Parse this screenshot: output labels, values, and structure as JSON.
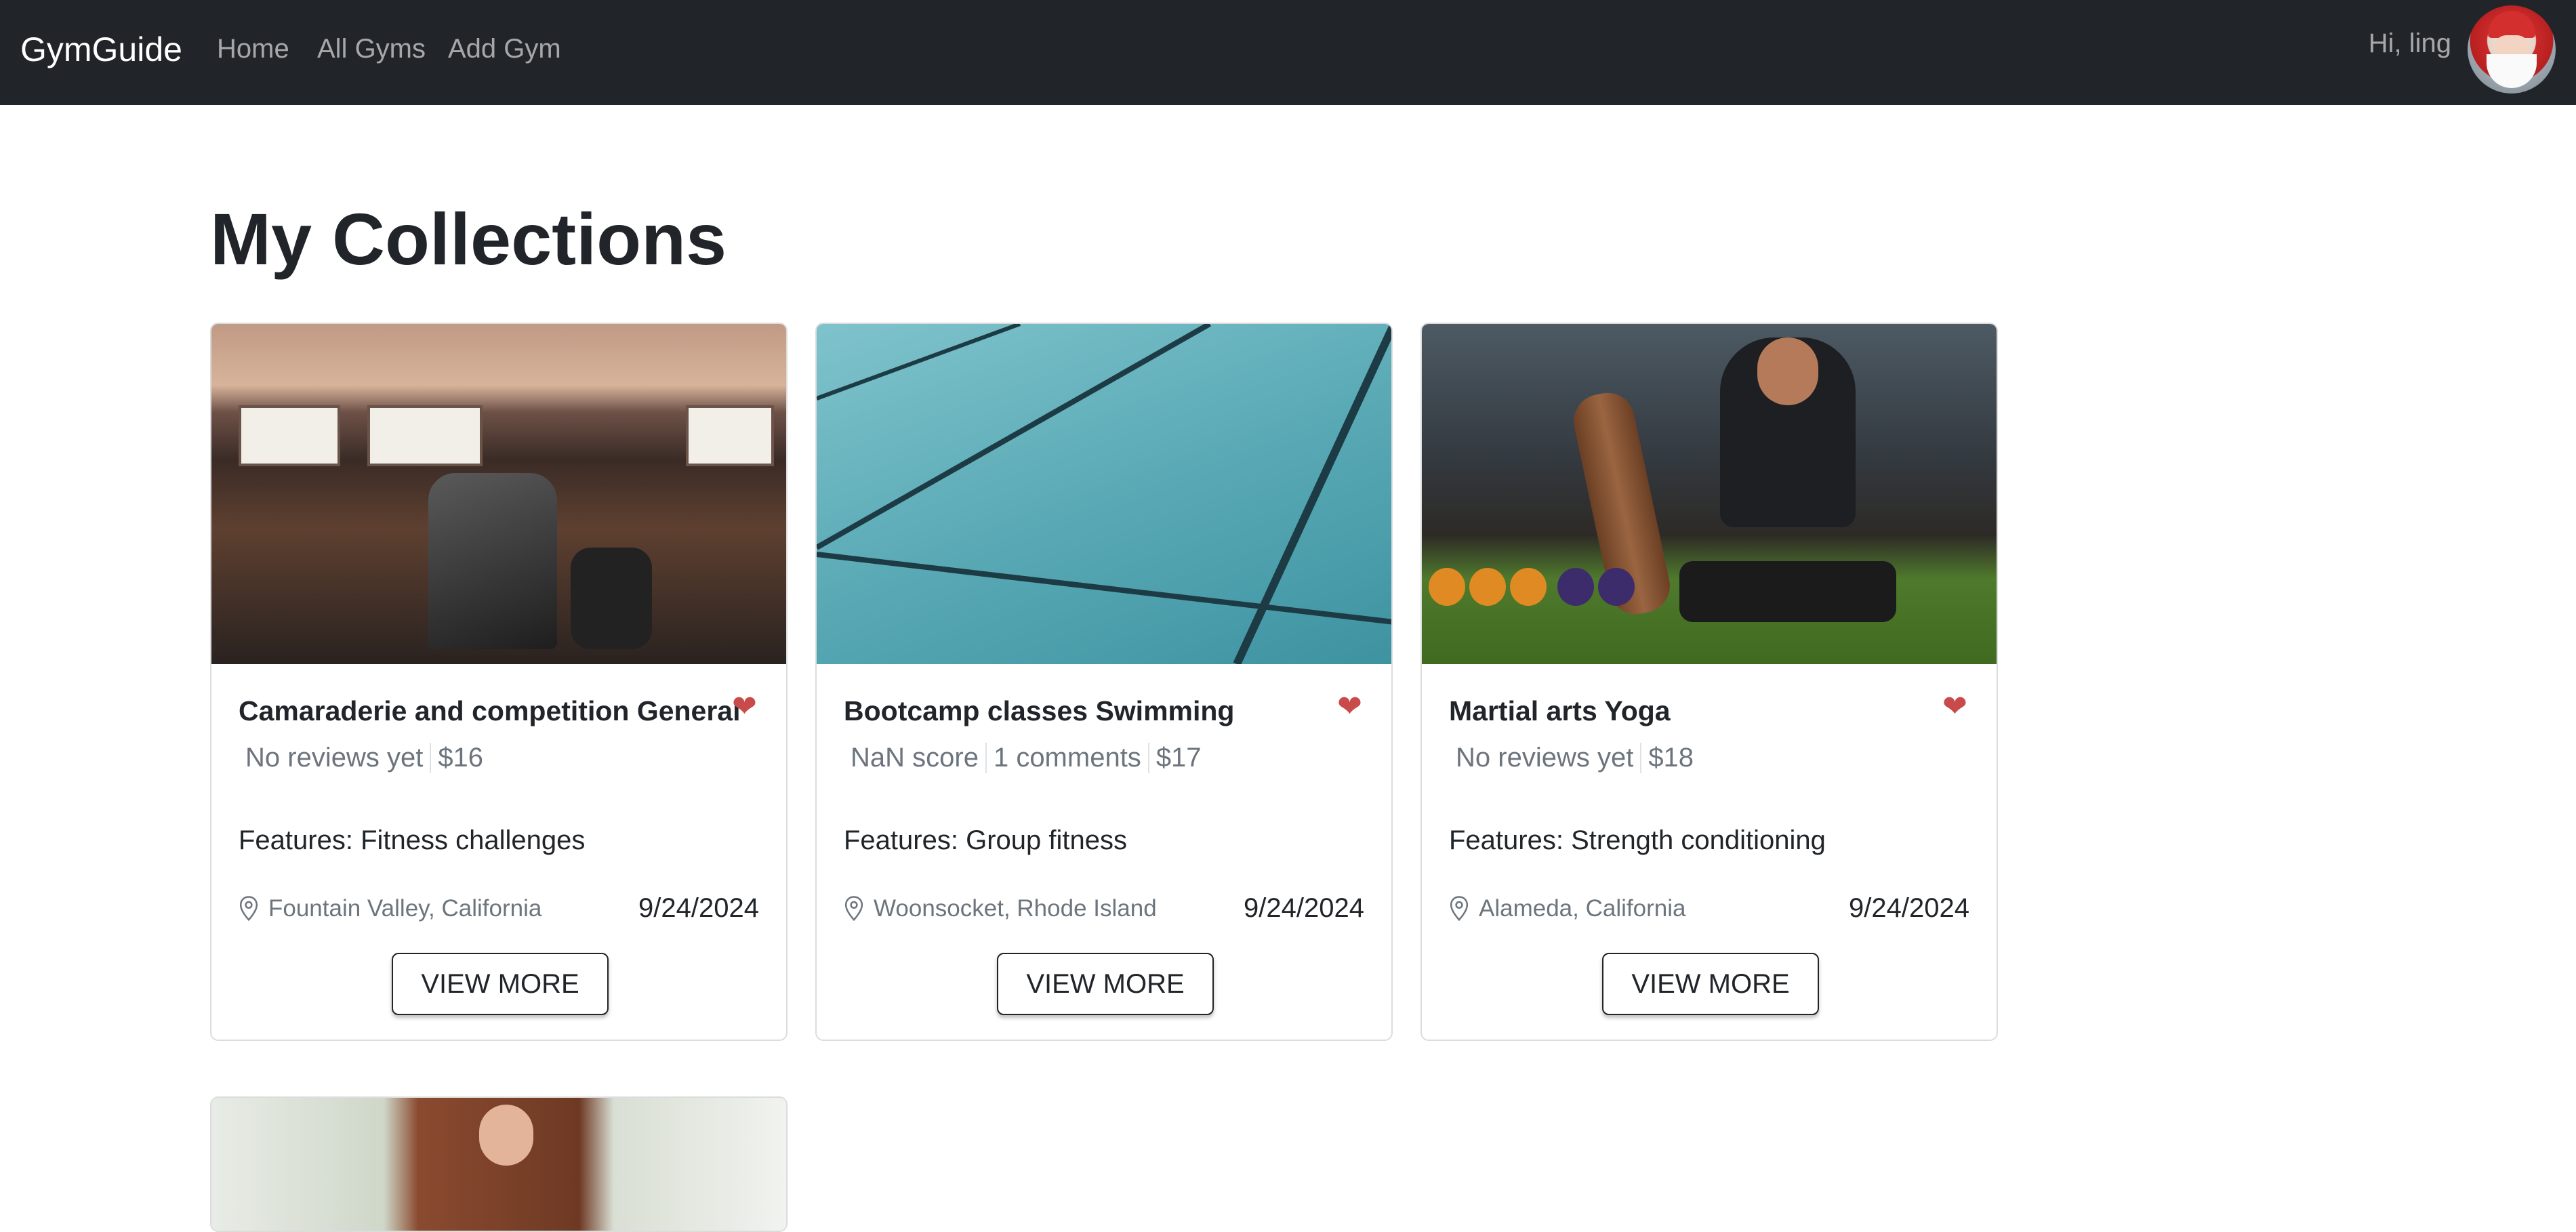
{
  "nav": {
    "brand": "GymGuide",
    "links": [
      "Home",
      "All Gyms",
      "Add Gym"
    ],
    "greeting": "Hi, ling"
  },
  "page": {
    "title": "My Collections"
  },
  "cards": [
    {
      "title": "Camaraderie and competition General",
      "meta": [
        "No reviews yet",
        "$16"
      ],
      "features": "Features: Fitness challenges",
      "location": "Fountain Valley, California",
      "date": "9/24/2024",
      "button": "VIEW MORE"
    },
    {
      "title": "Bootcamp classes Swimming",
      "meta": [
        "NaN score",
        "1 comments",
        "$17"
      ],
      "features": "Features: Group fitness",
      "location": "Woonsocket, Rhode Island",
      "date": "9/24/2024",
      "button": "VIEW MORE"
    },
    {
      "title": "Martial arts Yoga",
      "meta": [
        "No reviews yet",
        "$18"
      ],
      "features": "Features: Strength conditioning",
      "location": "Alameda, California",
      "date": "9/24/2024",
      "button": "VIEW MORE"
    }
  ],
  "colors": {
    "navbar": "#212529",
    "heart": "#c94a4a"
  },
  "icons": {
    "heart": "heart-icon",
    "location": "map-pin-icon"
  }
}
